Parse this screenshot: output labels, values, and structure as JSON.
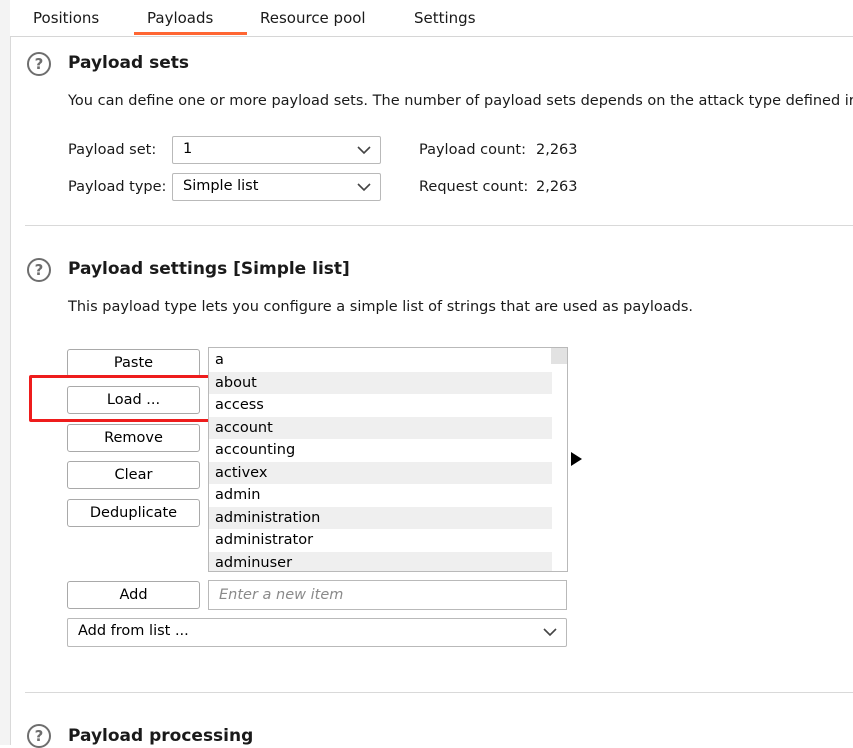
{
  "tabs": [
    {
      "label": "Positions"
    },
    {
      "label": "Payloads"
    },
    {
      "label": "Resource pool"
    },
    {
      "label": "Settings"
    }
  ],
  "active_tab": "Payloads",
  "accent_color": "#ff6633",
  "highlight_color": "#ee1c1c",
  "payload_sets": {
    "title": "Payload sets",
    "description": "You can define one or more payload sets. The number of payload sets depends on the attack type defined ir",
    "set_label": "Payload set:",
    "set_value": "1",
    "type_label": "Payload type:",
    "type_value": "Simple list",
    "payload_count_label": "Payload count:",
    "payload_count_value": "2,263",
    "request_count_label": "Request count:",
    "request_count_value": "2,263"
  },
  "payload_settings": {
    "title": "Payload settings [Simple list]",
    "description": "This payload type lets you configure a simple list of strings that are used as payloads.",
    "buttons": {
      "paste": "Paste",
      "load": "Load ...",
      "remove": "Remove",
      "clear": "Clear",
      "deduplicate": "Deduplicate",
      "add": "Add"
    },
    "items": [
      "a",
      "about",
      "access",
      "account",
      "accounting",
      "activex",
      "admin",
      "administration",
      "administrator",
      "adminuser"
    ],
    "add_input_placeholder": "Enter a new item",
    "add_from_list_value": "Add from list ..."
  },
  "payload_processing": {
    "title": "Payload processing"
  }
}
